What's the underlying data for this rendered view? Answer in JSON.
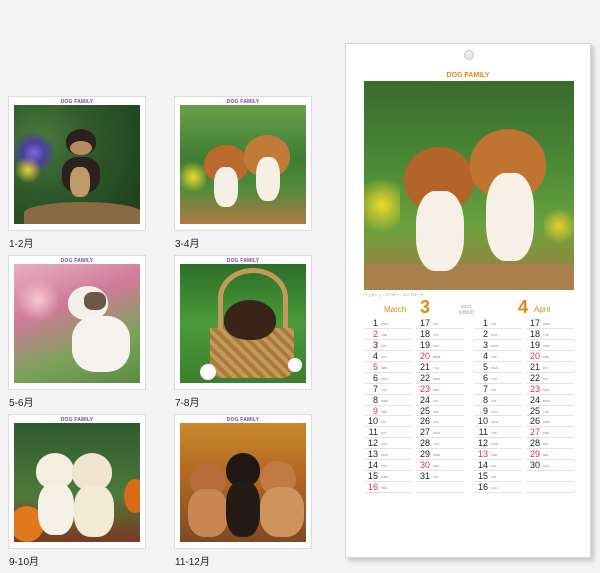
{
  "brand": "DOG FAMILY",
  "thumbnails": [
    {
      "caption": "1-2月"
    },
    {
      "caption": "3-4月"
    },
    {
      "caption": "5-6月"
    },
    {
      "caption": "7-8月"
    },
    {
      "caption": "9-10月"
    },
    {
      "caption": "11-12月"
    }
  ],
  "main": {
    "brand": "DOG FAMILY",
    "year": "2023",
    "year_jp": "令和5年",
    "credit": "ウェルシュ・コーギー・ペンブローク",
    "left_month": {
      "name": "March",
      "number": "3"
    },
    "right_month": {
      "name": "April",
      "number": "4"
    },
    "columns": [
      {
        "days": [
          {
            "n": "1",
            "d": "WED",
            "red": false
          },
          {
            "n": "2",
            "d": "THU",
            "red": true
          },
          {
            "n": "3",
            "d": "FRI",
            "red": false
          },
          {
            "n": "4",
            "d": "SAT",
            "red": false
          },
          {
            "n": "5",
            "d": "SUN",
            "red": true
          },
          {
            "n": "6",
            "d": "MON",
            "red": false
          },
          {
            "n": "7",
            "d": "TUE",
            "red": false
          },
          {
            "n": "8",
            "d": "WED",
            "red": false
          },
          {
            "n": "9",
            "d": "THU",
            "red": true
          },
          {
            "n": "10",
            "d": "FRI",
            "red": false
          },
          {
            "n": "11",
            "d": "SAT",
            "red": false
          },
          {
            "n": "12",
            "d": "SUN",
            "red": false
          },
          {
            "n": "13",
            "d": "MON",
            "red": false
          },
          {
            "n": "14",
            "d": "TUE",
            "red": false
          },
          {
            "n": "15",
            "d": "WED",
            "red": false
          },
          {
            "n": "16",
            "d": "THU",
            "red": true
          }
        ]
      },
      {
        "days": [
          {
            "n": "17",
            "d": "FRI",
            "red": false
          },
          {
            "n": "18",
            "d": "SAT",
            "red": false
          },
          {
            "n": "19",
            "d": "SUN",
            "red": false
          },
          {
            "n": "20",
            "d": "MON",
            "red": true
          },
          {
            "n": "21",
            "d": "TUE",
            "red": false
          },
          {
            "n": "22",
            "d": "WED",
            "red": false
          },
          {
            "n": "23",
            "d": "THU",
            "red": true
          },
          {
            "n": "24",
            "d": "FRI",
            "red": false
          },
          {
            "n": "25",
            "d": "SAT",
            "red": false
          },
          {
            "n": "26",
            "d": "SUN",
            "red": false
          },
          {
            "n": "27",
            "d": "MON",
            "red": false
          },
          {
            "n": "28",
            "d": "TUE",
            "red": false
          },
          {
            "n": "29",
            "d": "WED",
            "red": false
          },
          {
            "n": "30",
            "d": "THU",
            "red": true
          },
          {
            "n": "31",
            "d": "FRI",
            "red": false
          },
          {
            "n": "",
            "d": "",
            "red": false
          }
        ]
      },
      {
        "days": [
          {
            "n": "1",
            "d": "SAT",
            "red": false
          },
          {
            "n": "2",
            "d": "SUN",
            "red": false
          },
          {
            "n": "3",
            "d": "MON",
            "red": false
          },
          {
            "n": "4",
            "d": "TUE",
            "red": false
          },
          {
            "n": "5",
            "d": "WED",
            "red": false
          },
          {
            "n": "6",
            "d": "THU",
            "red": false
          },
          {
            "n": "7",
            "d": "FRI",
            "red": false
          },
          {
            "n": "8",
            "d": "SAT",
            "red": false
          },
          {
            "n": "9",
            "d": "SUN",
            "red": false
          },
          {
            "n": "10",
            "d": "MON",
            "red": false
          },
          {
            "n": "11",
            "d": "TUE",
            "red": false
          },
          {
            "n": "12",
            "d": "WED",
            "red": false
          },
          {
            "n": "13",
            "d": "THU",
            "red": true
          },
          {
            "n": "14",
            "d": "FRI",
            "red": false
          },
          {
            "n": "15",
            "d": "SAT",
            "red": false
          },
          {
            "n": "16",
            "d": "SUN",
            "red": false
          }
        ]
      },
      {
        "days": [
          {
            "n": "17",
            "d": "MON",
            "red": false
          },
          {
            "n": "18",
            "d": "TUE",
            "red": false
          },
          {
            "n": "19",
            "d": "WED",
            "red": false
          },
          {
            "n": "20",
            "d": "THU",
            "red": true
          },
          {
            "n": "21",
            "d": "FRI",
            "red": false
          },
          {
            "n": "22",
            "d": "SAT",
            "red": false
          },
          {
            "n": "23",
            "d": "SUN",
            "red": true
          },
          {
            "n": "24",
            "d": "MON",
            "red": false
          },
          {
            "n": "25",
            "d": "TUE",
            "red": false
          },
          {
            "n": "26",
            "d": "WED",
            "red": false
          },
          {
            "n": "27",
            "d": "THU",
            "red": true
          },
          {
            "n": "28",
            "d": "FRI",
            "red": false
          },
          {
            "n": "29",
            "d": "SAT",
            "red": true
          },
          {
            "n": "30",
            "d": "SUN",
            "red": false
          },
          {
            "n": "",
            "d": "",
            "red": false
          },
          {
            "n": "",
            "d": "",
            "red": false
          }
        ]
      }
    ]
  }
}
